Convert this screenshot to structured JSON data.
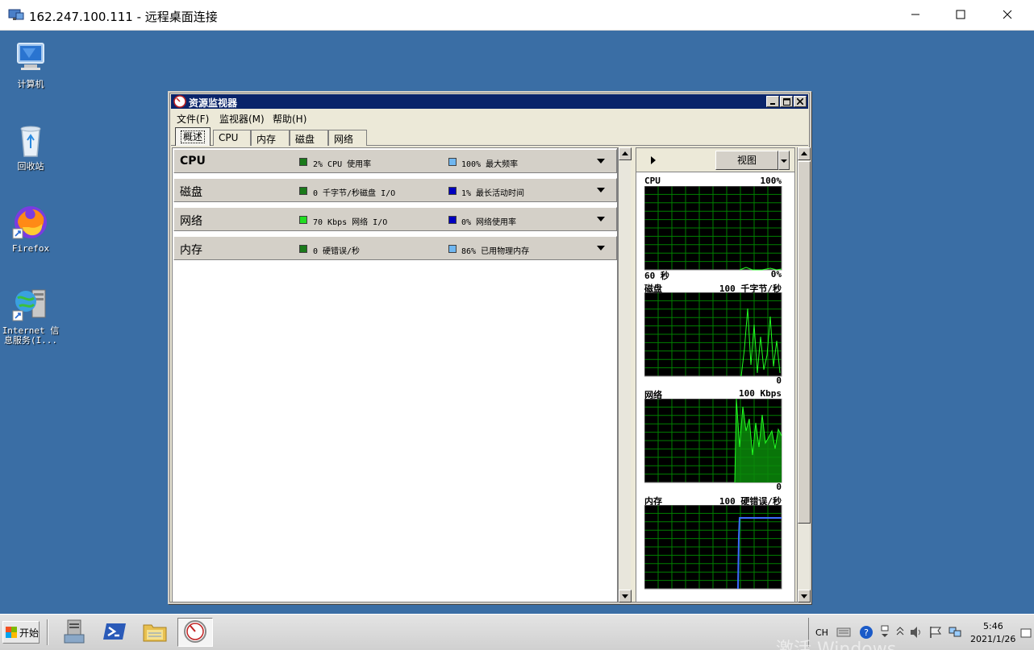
{
  "rdp": {
    "title": "162.247.100.111 - 远程桌面连接"
  },
  "desktop_icons": [
    {
      "label": "计算机",
      "icon": "computer-icon"
    },
    {
      "label": "回收站",
      "icon": "recycle-bin-icon"
    },
    {
      "label": "Firefox",
      "icon": "firefox-icon"
    },
    {
      "label": "Internet 信息服务(I...",
      "icon": "iis-manager-icon"
    }
  ],
  "resmon": {
    "title": "资源监视器",
    "menu": [
      "文件(F)",
      "监视器(M)",
      "帮助(H)"
    ],
    "tabs": [
      "概述",
      "CPU",
      "内存",
      "磁盘",
      "网络"
    ],
    "active_tab": "概述",
    "sections": [
      {
        "name": "CPU",
        "stat1": "2% CPU 使用率",
        "stat2": "100% 最大频率",
        "color1": "#1a7a1a",
        "color2": "#6fb6f0"
      },
      {
        "name": "磁盘",
        "stat1": "0 千字节/秒磁盘 I/O",
        "stat2": "1% 最长活动时间",
        "color1": "#1a7a1a",
        "color2": "#0000c0"
      },
      {
        "name": "网络",
        "stat1": "70 Kbps 网络 I/O",
        "stat2": "0% 网络使用率",
        "color1": "#22dd22",
        "color2": "#0000c0"
      },
      {
        "name": "内存",
        "stat1": "0 硬错误/秒",
        "stat2": "86% 已用物理内存",
        "color1": "#1a7a1a",
        "color2": "#6fb6f0"
      }
    ],
    "view_button": "视图",
    "graphs": [
      {
        "label": "CPU",
        "max": "100%",
        "min": "0%",
        "time": "60 秒"
      },
      {
        "label": "磁盘",
        "max": "100 千字节/秒",
        "min": "0",
        "time": ""
      },
      {
        "label": "网络",
        "max": "100 Kbps",
        "min": "0",
        "time": ""
      },
      {
        "label": "内存",
        "max": "100 硬错误/秒",
        "min": "",
        "time": ""
      }
    ]
  },
  "taskbar": {
    "start_label": "开始",
    "apps": [
      "server-manager-icon",
      "powershell-icon",
      "file-explorer-icon",
      "resource-monitor-icon"
    ],
    "tray_lang": "CH",
    "time": "5:46",
    "date": "2021/1/26",
    "watermark": "激活 Windows"
  },
  "colors": {
    "desktop": "#3a6ea5",
    "titlebar_active": "#0a246a",
    "graph_bg": "#000000",
    "graph_grid": "#008000",
    "graph_line": "#22ff22",
    "memory_line": "#3b6bff"
  }
}
